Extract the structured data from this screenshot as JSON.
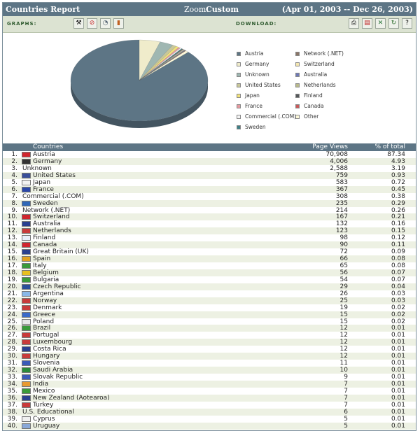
{
  "header": {
    "title": "Countries Report",
    "zoom_label": "Zoom:",
    "zoom_value": "Custom",
    "date_range": "(Apr 01, 2003 -- Dec 26, 2003)"
  },
  "toolbar": {
    "graphs_label": "GRAPHS:",
    "download_label": "DOWNLOAD:",
    "graph_buttons": [
      "tools-icon",
      "no-chart-icon",
      "pie-chart-icon",
      "bar-chart-icon"
    ],
    "download_buttons": [
      "print-icon",
      "pdf-icon",
      "excel-icon",
      "refresh-icon",
      "help-icon"
    ]
  },
  "table": {
    "headers": {
      "country": "Countries",
      "page_views": "Page Views",
      "percent": "% of total"
    },
    "rows": [
      {
        "rank": "1.",
        "name": "Austria",
        "pv": "70,908",
        "pct": "87.34",
        "flag": "#d0262e"
      },
      {
        "rank": "2.",
        "name": "Germany",
        "pv": "4,006",
        "pct": "4.93",
        "flag": "#333333"
      },
      {
        "rank": "3.",
        "name": "Unknown",
        "pv": "2,588",
        "pct": "3.19",
        "flag": ""
      },
      {
        "rank": "4.",
        "name": "United States",
        "pv": "759",
        "pct": "0.93",
        "flag": "#3a4f9a"
      },
      {
        "rank": "5.",
        "name": "Japan",
        "pv": "583",
        "pct": "0.72",
        "flag": "#f2f2f2"
      },
      {
        "rank": "6.",
        "name": "France",
        "pv": "367",
        "pct": "0.45",
        "flag": "#2b47a8"
      },
      {
        "rank": "7.",
        "name": "Commercial (.COM)",
        "pv": "308",
        "pct": "0.38",
        "flag": ""
      },
      {
        "rank": "8.",
        "name": "Sweden",
        "pv": "235",
        "pct": "0.29",
        "flag": "#2f67b7"
      },
      {
        "rank": "9.",
        "name": "Network (.NET)",
        "pv": "214",
        "pct": "0.26",
        "flag": ""
      },
      {
        "rank": "10.",
        "name": "Switzerland",
        "pv": "167",
        "pct": "0.21",
        "flag": "#d0262e"
      },
      {
        "rank": "11.",
        "name": "Australia",
        "pv": "132",
        "pct": "0.16",
        "flag": "#2a3f8f"
      },
      {
        "rank": "12.",
        "name": "Netherlands",
        "pv": "123",
        "pct": "0.15",
        "flag": "#c83a3a"
      },
      {
        "rank": "13.",
        "name": "Finland",
        "pv": "98",
        "pct": "0.12",
        "flag": "#e8eef8"
      },
      {
        "rank": "14.",
        "name": "Canada",
        "pv": "90",
        "pct": "0.11",
        "flag": "#d0262e"
      },
      {
        "rank": "15.",
        "name": "Great Britain (UK)",
        "pv": "72",
        "pct": "0.09",
        "flag": "#2a3f8f"
      },
      {
        "rank": "16.",
        "name": "Spain",
        "pv": "66",
        "pct": "0.08",
        "flag": "#e0a020"
      },
      {
        "rank": "17.",
        "name": "Italy",
        "pv": "65",
        "pct": "0.08",
        "flag": "#3a9a3a"
      },
      {
        "rank": "18.",
        "name": "Belgium",
        "pv": "56",
        "pct": "0.07",
        "flag": "#e8c020"
      },
      {
        "rank": "19.",
        "name": "Bulgaria",
        "pv": "54",
        "pct": "0.07",
        "flag": "#3a9a3a"
      },
      {
        "rank": "20.",
        "name": "Czech Republic",
        "pv": "29",
        "pct": "0.04",
        "flag": "#2a4f9a"
      },
      {
        "rank": "21.",
        "name": "Argentina",
        "pv": "26",
        "pct": "0.03",
        "flag": "#8ab8e8"
      },
      {
        "rank": "22.",
        "name": "Norway",
        "pv": "25",
        "pct": "0.03",
        "flag": "#c83a3a"
      },
      {
        "rank": "23.",
        "name": "Denmark",
        "pv": "19",
        "pct": "0.02",
        "flag": "#c83a3a"
      },
      {
        "rank": "24.",
        "name": "Greece",
        "pv": "15",
        "pct": "0.02",
        "flag": "#3a6ac8"
      },
      {
        "rank": "25.",
        "name": "Poland",
        "pv": "15",
        "pct": "0.02",
        "flag": "#e8e8e8"
      },
      {
        "rank": "26.",
        "name": "Brazil",
        "pv": "12",
        "pct": "0.01",
        "flag": "#3a9a3a"
      },
      {
        "rank": "27.",
        "name": "Portugal",
        "pv": "12",
        "pct": "0.01",
        "flag": "#c83a3a"
      },
      {
        "rank": "28.",
        "name": "Luxembourg",
        "pv": "12",
        "pct": "0.01",
        "flag": "#c83a3a"
      },
      {
        "rank": "29.",
        "name": "Costa Rica",
        "pv": "12",
        "pct": "0.01",
        "flag": "#2a3f8f"
      },
      {
        "rank": "30.",
        "name": "Hungary",
        "pv": "12",
        "pct": "0.01",
        "flag": "#c83a3a"
      },
      {
        "rank": "31.",
        "name": "Slovenia",
        "pv": "11",
        "pct": "0.01",
        "flag": "#3a5ab8"
      },
      {
        "rank": "32.",
        "name": "Saudi Arabia",
        "pv": "10",
        "pct": "0.01",
        "flag": "#2a8a3a"
      },
      {
        "rank": "33.",
        "name": "Slovak Republic",
        "pv": "9",
        "pct": "0.01",
        "flag": "#3a5ab8"
      },
      {
        "rank": "34.",
        "name": "India",
        "pv": "7",
        "pct": "0.01",
        "flag": "#e89a30"
      },
      {
        "rank": "35.",
        "name": "Mexico",
        "pv": "7",
        "pct": "0.01",
        "flag": "#3a9a3a"
      },
      {
        "rank": "36.",
        "name": "New Zealand (Aotearoa)",
        "pv": "7",
        "pct": "0.01",
        "flag": "#2a3f8f"
      },
      {
        "rank": "37.",
        "name": "Turkey",
        "pv": "7",
        "pct": "0.01",
        "flag": "#c83a3a"
      },
      {
        "rank": "38.",
        "name": "U.S. Educational",
        "pv": "6",
        "pct": "0.01",
        "flag": ""
      },
      {
        "rank": "39.",
        "name": "Cyprus",
        "pv": "5",
        "pct": "0.01",
        "flag": "#f0f0f0"
      },
      {
        "rank": "40.",
        "name": "Uruguay",
        "pv": "5",
        "pct": "0.01",
        "flag": "#8aa8d8"
      }
    ]
  },
  "chart_data": {
    "type": "pie",
    "categories": [
      "Austria",
      "Germany",
      "Unknown",
      "United States",
      "Japan",
      "France",
      "Commercial (.COM)",
      "Sweden",
      "Network (.NET)",
      "Switzerland",
      "Australia",
      "Netherlands",
      "Finland",
      "Canada",
      "Other"
    ],
    "values": [
      87.34,
      4.93,
      3.19,
      0.93,
      0.72,
      0.45,
      0.38,
      0.29,
      0.26,
      0.21,
      0.16,
      0.15,
      0.12,
      0.11,
      0.76
    ],
    "colors": [
      "#5d7585",
      "#f0eccb",
      "#9fb7b2",
      "#c9c89a",
      "#f2e27a",
      "#e69aa0",
      "#f4f4f4",
      "#3f7f86",
      "#8a7668",
      "#f3e6b0",
      "#6f79b5",
      "#b9ba8b",
      "#55585a",
      "#c9595a",
      "#fbf7d8"
    ],
    "legend": {
      "left": [
        "Austria",
        "Germany",
        "Unknown",
        "United States",
        "Japan",
        "France",
        "Commercial (.COM)",
        "Sweden"
      ],
      "right": [
        "Network (.NET)",
        "Switzerland",
        "Australia",
        "Netherlands",
        "Finland",
        "Canada",
        "Other"
      ]
    }
  }
}
